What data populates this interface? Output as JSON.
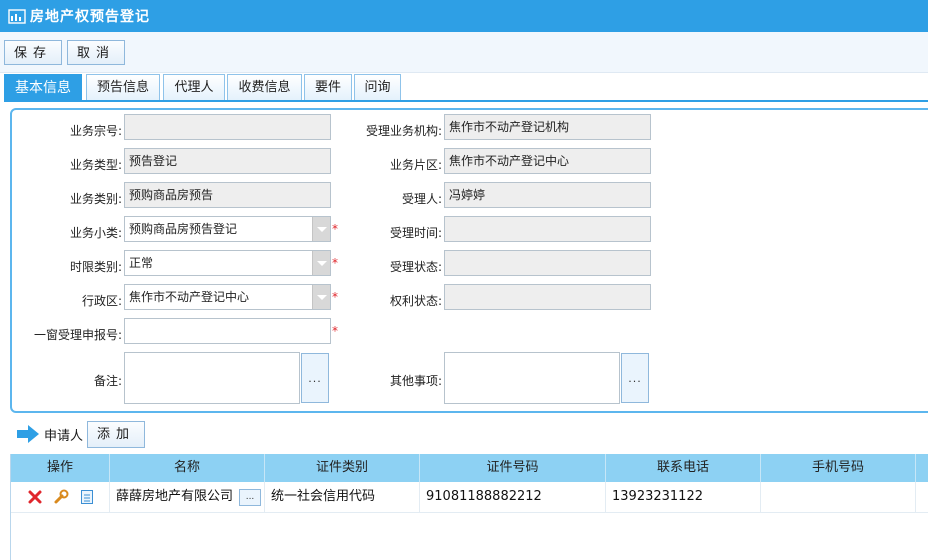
{
  "title": "房地产权预告登记",
  "toolbar": {
    "save": "保存",
    "cancel": "取消"
  },
  "tabs": [
    "基本信息",
    "预告信息",
    "代理人",
    "收费信息",
    "要件",
    "问询"
  ],
  "form": {
    "biz_no": {
      "label": "业务宗号:",
      "value": ""
    },
    "biz_type": {
      "label": "业务类型:",
      "value": "预告登记"
    },
    "biz_cat": {
      "label": "业务类别:",
      "value": "预购商品房预告"
    },
    "biz_sub": {
      "label": "业务小类:",
      "value": "预购商品房预告登记"
    },
    "time_type": {
      "label": "时限类别:",
      "value": "正常"
    },
    "district": {
      "label": "行政区:",
      "value": "焦作市不动产登记中心"
    },
    "window_no": {
      "label": "一窗受理申报号:",
      "value": ""
    },
    "remark": {
      "label": "备注:",
      "value": ""
    },
    "org": {
      "label": "受理业务机构:",
      "value": "焦作市不动产登记机构"
    },
    "area": {
      "label": "业务片区:",
      "value": "焦作市不动产登记中心"
    },
    "handler": {
      "label": "受理人:",
      "value": "冯婷婷"
    },
    "accept_time": {
      "label": "受理时间:",
      "value": ""
    },
    "accept_status": {
      "label": "受理状态:",
      "value": ""
    },
    "right_status": {
      "label": "权利状态:",
      "value": ""
    },
    "other": {
      "label": "其他事项:",
      "value": ""
    },
    "required_mark": "*",
    "dots": "..."
  },
  "applicant": {
    "label": "申请人",
    "add": "添加"
  },
  "grid": {
    "headers": [
      "操作",
      "名称",
      "证件类别",
      "证件号码",
      "联系电话",
      "手机号码"
    ],
    "rows": [
      {
        "name": "薛薛房地产有限公司",
        "id_type": "统一社会信用代码",
        "id_no": "91081188882212",
        "phone": "13923231122",
        "mobile": ""
      }
    ]
  },
  "colors": {
    "accent": "#2e9fe5",
    "grid_header": "#8dd1f3",
    "required": "#e0262c"
  }
}
